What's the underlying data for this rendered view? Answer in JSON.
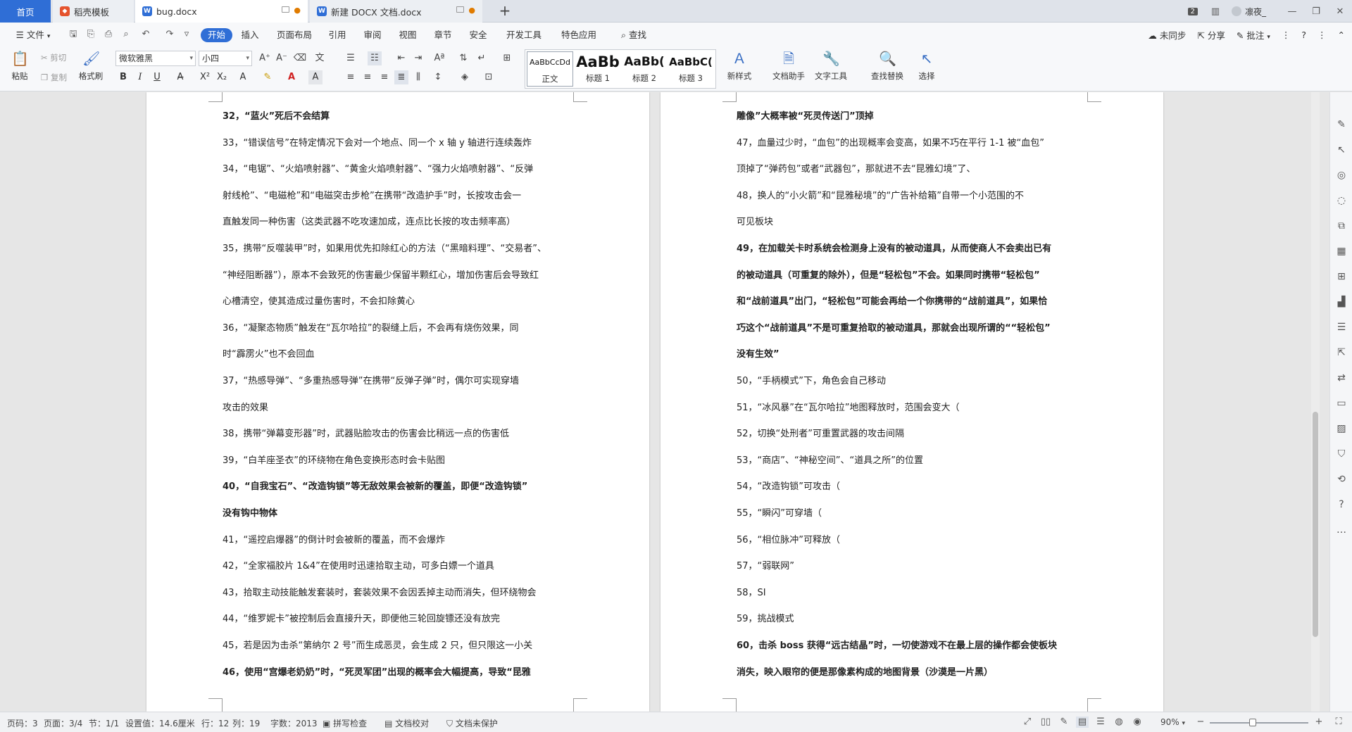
{
  "tabs": {
    "home": "首页",
    "template": "稻壳模板",
    "doc1": "bug.docx",
    "doc2": "新建 DOCX 文档.docx"
  },
  "window": {
    "badge": "2",
    "user": "凛夜_"
  },
  "menu": {
    "file": "文件",
    "items": [
      "开始",
      "插入",
      "页面布局",
      "引用",
      "审阅",
      "视图",
      "章节",
      "安全",
      "开发工具",
      "特色应用"
    ],
    "search": "查找",
    "sync": "未同步",
    "share": "分享",
    "comment": "批注"
  },
  "ribbon": {
    "paste": "粘贴",
    "cut": "剪切",
    "copy": "复制",
    "format_painter": "格式刷",
    "font_name": "微软雅黑",
    "font_size": "小四",
    "styles": [
      {
        "preview": "AaBbCcDd",
        "name": "正文"
      },
      {
        "preview": "AaBb",
        "name": "标题 1"
      },
      {
        "preview": "AaBb(",
        "name": "标题 2"
      },
      {
        "preview": "AaBbC(",
        "name": "标题 3"
      }
    ],
    "new_style": "新样式",
    "doc_helper": "文档助手",
    "text_tools": "文字工具",
    "find_replace": "查找替换",
    "select": "选择"
  },
  "doc": {
    "left": [
      {
        "text": "32，“蓝火”死后不会结算",
        "bold": true
      },
      {
        "text": "33，“错误信号”在特定情况下会对一个地点、同一个 x 轴 y 轴进行连续轰炸",
        "bold": false
      },
      {
        "text": "34，“电锯”、“火焰喷射器”、“黄金火焰喷射器”、“强力火焰喷射器”、“反弹",
        "bold": false
      },
      {
        "text": "射线枪”、“电磁枪”和“电磁突击步枪”在携带“改造护手”时，长按攻击会一",
        "bold": false
      },
      {
        "text": "直触发同一种伤害（这类武器不吃攻速加成，连点比长按的攻击频率高）",
        "bold": false
      },
      {
        "text": "35，携带“反噬装甲”时，如果用优先扣除红心的方法（“黑暗料理”、“交易者”、",
        "bold": false
      },
      {
        "text": "“神经阻断器”），原本不会致死的伤害最少保留半颗红心，增加伤害后会导致红",
        "bold": false
      },
      {
        "text": "心槽清空，使其造成过量伤害时，不会扣除黄心",
        "bold": false
      },
      {
        "text": "36，“凝聚态物质”触发在“瓦尔哈拉”的裂缝上后，不会再有烧伤效果，同",
        "bold": false
      },
      {
        "text": "时“霹雳火”也不会回血",
        "bold": false
      },
      {
        "text": "37，“热感导弹”、“多重热感导弹”在携带“反弹子弹”时，偶尔可实现穿墙",
        "bold": false
      },
      {
        "text": "攻击的效果",
        "bold": false
      },
      {
        "text": "38，携带“弹幕变形器”时，武器贴脸攻击的伤害会比稍远一点的伤害低",
        "bold": false
      },
      {
        "text": "39，“白羊座圣衣”的环绕物在角色变换形态时会卡贴图",
        "bold": false
      },
      {
        "text": "40，“自我宝石”、“改造钩锁”等无敌效果会被新的覆盖，即便“改造钩锁”",
        "bold": true
      },
      {
        "text": "没有钩中物体",
        "bold": true
      },
      {
        "text": "41，“遥控启爆器”的倒计时会被新的覆盖，而不会爆炸",
        "bold": false
      },
      {
        "text": "42，“全家福胶片 1&4”在使用时迅速拾取主动，可多白嫖一个道具",
        "bold": false
      },
      {
        "text": "43，拾取主动技能触发套装时，套装效果不会因丢掉主动而消失，但环绕物会",
        "bold": false
      },
      {
        "text": "44，“维罗妮卡”被控制后会直接升天，即便他三轮回旋镖还没有放完",
        "bold": false
      },
      {
        "text": "45，若是因为击杀“第纳尔 2 号”而生成恶灵，会生成 2 只，但只限这一小关",
        "bold": false
      },
      {
        "text": "46，使用“宫爆老奶奶”时，“死灵军团”出现的概率会大幅提高，导致“昆雅",
        "bold": true
      }
    ],
    "right": [
      {
        "text": "雕像”大概率被“死灵传送门”顶掉",
        "bold": true
      },
      {
        "text": "47，血量过少时，“血包”的出现概率会变高，如果不巧在平行 1-1 被“血包”",
        "bold": false
      },
      {
        "text": "顶掉了“弹药包”或者“武器包”，那就进不去“昆雅幻境”了、",
        "bold": false
      },
      {
        "text": "48，换人的“小火箭”和“昆雅秘境”的“广告补给箱”自带一个小范围的不",
        "bold": false
      },
      {
        "text": "可见板块",
        "bold": false
      },
      {
        "text": "49，在加载关卡时系统会检测身上没有的被动道具，从而使商人不会卖出已有",
        "bold": true
      },
      {
        "text": "的被动道具（可重复的除外），但是“轻松包”不会。如果同时携带“轻松包”",
        "bold": true
      },
      {
        "text": "和“战前道具”出门，“轻松包”可能会再给一个你携带的“战前道具”，如果恰",
        "bold": true
      },
      {
        "text": "巧这个“战前道具”不是可重复拾取的被动道具，那就会出现所谓的““轻松包”",
        "bold": true
      },
      {
        "text": "没有生效”",
        "bold": true
      },
      {
        "text": "50，“手柄模式”下，角色会自己移动",
        "bold": false
      },
      {
        "text": "51，“冰风暴”在“瓦尔哈拉”地图释放时，范围会变大（",
        "bold": false
      },
      {
        "text": "52，切换“处刑者”可重置武器的攻击间隔",
        "bold": false
      },
      {
        "text": "53，“商店”、“神秘空间”、“道具之所”的位置",
        "bold": false
      },
      {
        "text": "54，“改造钩锁”可攻击（",
        "bold": false
      },
      {
        "text": "55，“瞬闪”可穿墙（",
        "bold": false
      },
      {
        "text": "56，“相位脉冲”可释放（",
        "bold": false
      },
      {
        "text": "57，“弱联网”",
        "bold": false
      },
      {
        "text": "58，SI",
        "bold": false
      },
      {
        "text": "59，挑战模式",
        "bold": false
      },
      {
        "text": "60，击杀 boss 获得“远古结晶”时，一切使游戏不在最上层的操作都会使板块",
        "bold": true
      },
      {
        "text": "消失，映入眼帘的便是那像素构成的地图背景（沙漠是一片黑）",
        "bold": true
      }
    ]
  },
  "status": {
    "page_num": "页码：3",
    "pages": "页面：3/4",
    "section": "节：1/1",
    "setting": "设置值：14.6厘米",
    "row": "行：12",
    "col": "列：19",
    "words": "字数：2013",
    "spellcheck": "拼写检查",
    "proofread": "文档校对",
    "protect": "文档未保护",
    "zoom": "90%"
  },
  "colors": {
    "accent": "#2f6ed6",
    "orange": "#e07b00"
  },
  "icons": [
    "menu-icon",
    "save-icon",
    "undo-icon",
    "redo-icon",
    "print-icon",
    "search-icon",
    "paste-icon",
    "scissors-icon",
    "brush-icon",
    "gear-icon"
  ]
}
